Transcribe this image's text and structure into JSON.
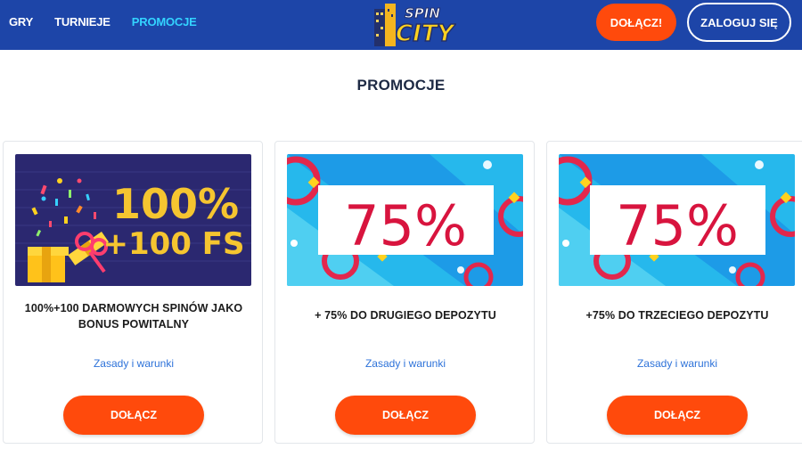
{
  "header": {
    "nav": [
      {
        "label": "GRY",
        "active": false
      },
      {
        "label": "TURNIEJE",
        "active": false
      },
      {
        "label": "PROMOCJE",
        "active": true
      }
    ],
    "logo_text": {
      "line1": "SPIN",
      "line2": "CITY"
    },
    "join_label": "DOŁĄCZ!",
    "login_label": "ZALOGUJ SIĘ"
  },
  "page": {
    "title": "PROMOCJE"
  },
  "promotions": [
    {
      "banner": {
        "line1": "100%",
        "line2": "+100 FS"
      },
      "title": "100%+100 DARMOWYCH SPINÓW JAKO BONUS POWITALNY",
      "terms": "Zasady i warunki",
      "cta": "DOŁĄCZ"
    },
    {
      "banner": {
        "text": "75%"
      },
      "title": "+ 75% DO DRUGIEGO DEPOZYTU",
      "terms": "Zasady i warunki",
      "cta": "DOŁĄCZ"
    },
    {
      "banner": {
        "text": "75%"
      },
      "title": "+75% DO TRZECIEGO DEPOZYTU",
      "terms": "Zasady i warunki",
      "cta": "DOŁĄCZ"
    }
  ],
  "colors": {
    "header_bg": "#1d45a8",
    "nav_active": "#33d3ff",
    "cta": "#ff4a0c",
    "link": "#2d72d9",
    "banner1_bg": "#2b2870",
    "banner1_text": "#f5c530",
    "banner75_bg": "#26b8ec",
    "banner75_text": "#d8143e"
  }
}
